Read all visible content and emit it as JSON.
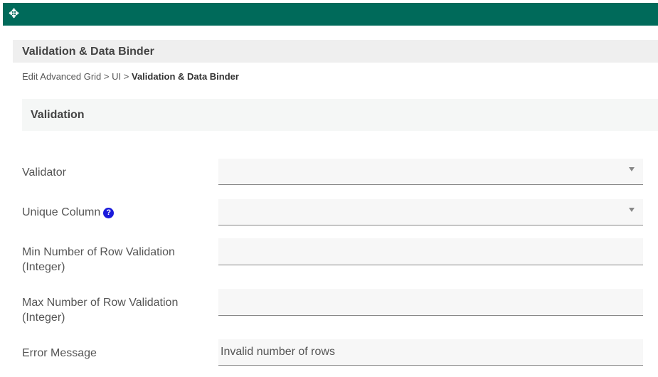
{
  "header": {
    "title": "Validation & Data Binder"
  },
  "breadcrumb": {
    "items": [
      "Edit Advanced Grid",
      ">",
      "UI",
      ">"
    ],
    "current": "Validation & Data Binder"
  },
  "section": {
    "title": "Validation"
  },
  "fields": {
    "validator": {
      "label": "Validator",
      "value": ""
    },
    "unique_column": {
      "label": "Unique Column",
      "value": "",
      "help": "?"
    },
    "min_rows": {
      "label_1": "Min Number of Row Validation",
      "label_2": "(Integer)",
      "value": ""
    },
    "max_rows": {
      "label_1": "Max Number of Row Validation",
      "label_2": "(Integer)",
      "value": ""
    },
    "error_message": {
      "label": "Error Message",
      "value": "Invalid number of rows"
    }
  }
}
